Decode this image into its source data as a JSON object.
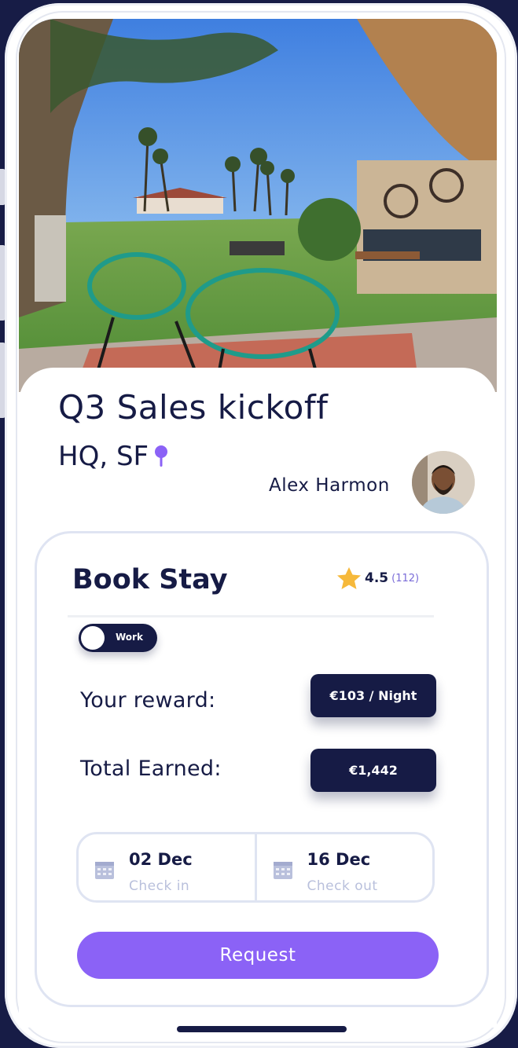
{
  "event": {
    "title": "Q3 Sales kickoff",
    "location": "HQ, SF",
    "host_name": "Alex Harmon"
  },
  "booking": {
    "heading": "Book Stay",
    "rating": "4.5",
    "rating_count": "(112)",
    "toggle_label": "Work",
    "toggle_on": false,
    "reward_label": "Your reward:",
    "reward_value": "€103 / Night",
    "earned_label": "Total Earned:",
    "earned_value": "€1,442",
    "check_in_date": "02 Dec",
    "check_in_label": "Check in",
    "check_out_date": "16 Dec",
    "check_out_label": "Check out",
    "request_label": "Request"
  },
  "icons": {
    "location": "map-pin-icon",
    "rating": "star-icon",
    "calendar": "calendar-icon"
  },
  "colors": {
    "background": "#171c46",
    "primary": "#161b45",
    "accent": "#8b62f6",
    "pin": "#8b62f6",
    "star": "#f6b93b"
  }
}
